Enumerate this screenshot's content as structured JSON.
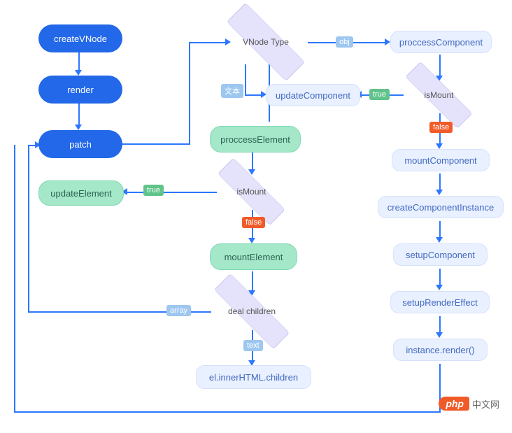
{
  "nodes": {
    "createVNode": "createVNode",
    "render": "render",
    "patch": "patch",
    "updateElement": "updateElement",
    "proccessElement": "proccessElement",
    "mountElement": "mountElement",
    "updateComponent": "updateComponent",
    "proccessComponent": "proccessComponent",
    "mountComponent": "mountComponent",
    "createComponentInstance": "createComponentInstance",
    "setupComponent": "setupComponent",
    "setupRenderEffect": "setupRenderEffect",
    "instanceRender": "instance.render()",
    "elInnerHTML": "el.innerHTML.children"
  },
  "diamonds": {
    "vnodeType": "VNode Type",
    "isMountLeft": "isMount",
    "dealChildren": "deal children",
    "isMountRight": "isMount"
  },
  "badges": {
    "obj": "obj",
    "text_cn": "文本",
    "true_left": "true",
    "false_left": "false",
    "true_right": "true",
    "false_right": "false",
    "array": "array",
    "text_en": "text"
  },
  "watermark": {
    "logo": "php",
    "text": "中文网"
  },
  "colors": {
    "arrow": "#2c77ff",
    "bluePill": "#2368e8",
    "lightBlue": "#e9f0ff",
    "greenPill": "#a4e8c9",
    "diamond": "#e4e3fb",
    "badgeBlue": "#9ec7f0",
    "badgeGreen": "#60c38b",
    "badgeOrange": "#f25b29"
  },
  "chart_data": {
    "type": "flowchart",
    "title": "",
    "nodes": [
      {
        "id": "createVNode",
        "label": "createVNode",
        "type": "process",
        "style": "blue-pill"
      },
      {
        "id": "render",
        "label": "render",
        "type": "process",
        "style": "blue-pill"
      },
      {
        "id": "patch",
        "label": "patch",
        "type": "process",
        "style": "blue-pill"
      },
      {
        "id": "vnodeType",
        "label": "VNode Type",
        "type": "decision",
        "style": "diamond"
      },
      {
        "id": "updateComponent",
        "label": "updateComponent",
        "type": "process",
        "style": "lightblue-pill"
      },
      {
        "id": "proccessElement",
        "label": "proccessElement",
        "type": "process",
        "style": "green-pill"
      },
      {
        "id": "isMountLeft",
        "label": "isMount",
        "type": "decision",
        "style": "diamond"
      },
      {
        "id": "updateElement",
        "label": "updateElement",
        "type": "process",
        "style": "green-pill"
      },
      {
        "id": "mountElement",
        "label": "mountElement",
        "type": "process",
        "style": "green-pill"
      },
      {
        "id": "dealChildren",
        "label": "deal children",
        "type": "decision",
        "style": "diamond"
      },
      {
        "id": "elInnerHTML",
        "label": "el.innerHTML.children",
        "type": "process",
        "style": "lightblue-pill"
      },
      {
        "id": "proccessComponent",
        "label": "proccessComponent",
        "type": "process",
        "style": "lightblue-pill"
      },
      {
        "id": "isMountRight",
        "label": "isMount",
        "type": "decision",
        "style": "diamond"
      },
      {
        "id": "mountComponent",
        "label": "mountComponent",
        "type": "process",
        "style": "lightblue-pill"
      },
      {
        "id": "createComponentInstance",
        "label": "createComponentInstance",
        "type": "process",
        "style": "lightblue-pill"
      },
      {
        "id": "setupComponent",
        "label": "setupComponent",
        "type": "process",
        "style": "lightblue-pill"
      },
      {
        "id": "setupRenderEffect",
        "label": "setupRenderEffect",
        "type": "process",
        "style": "lightblue-pill"
      },
      {
        "id": "instanceRender",
        "label": "instance.render()",
        "type": "process",
        "style": "lightblue-pill"
      }
    ],
    "edges": [
      {
        "from": "createVNode",
        "to": "render",
        "label": ""
      },
      {
        "from": "render",
        "to": "patch",
        "label": ""
      },
      {
        "from": "patch",
        "to": "vnodeType",
        "label": ""
      },
      {
        "from": "vnodeType",
        "to": "proccessComponent",
        "label": "obj"
      },
      {
        "from": "vnodeType",
        "to": "updateComponent",
        "label": "文本"
      },
      {
        "from": "vnodeType",
        "to": "proccessElement",
        "label": ""
      },
      {
        "from": "proccessElement",
        "to": "isMountLeft",
        "label": ""
      },
      {
        "from": "isMountLeft",
        "to": "updateElement",
        "label": "true"
      },
      {
        "from": "isMountLeft",
        "to": "mountElement",
        "label": "false"
      },
      {
        "from": "mountElement",
        "to": "dealChildren",
        "label": ""
      },
      {
        "from": "dealChildren",
        "to": "patch",
        "label": "array"
      },
      {
        "from": "dealChildren",
        "to": "elInnerHTML",
        "label": "text"
      },
      {
        "from": "proccessComponent",
        "to": "isMountRight",
        "label": ""
      },
      {
        "from": "isMountRight",
        "to": "updateComponent",
        "label": "true"
      },
      {
        "from": "isMountRight",
        "to": "mountComponent",
        "label": "false"
      },
      {
        "from": "mountComponent",
        "to": "createComponentInstance",
        "label": ""
      },
      {
        "from": "createComponentInstance",
        "to": "setupComponent",
        "label": ""
      },
      {
        "from": "setupComponent",
        "to": "setupRenderEffect",
        "label": ""
      },
      {
        "from": "setupRenderEffect",
        "to": "instanceRender",
        "label": ""
      },
      {
        "from": "instanceRender",
        "to": "patch",
        "label": ""
      }
    ]
  }
}
